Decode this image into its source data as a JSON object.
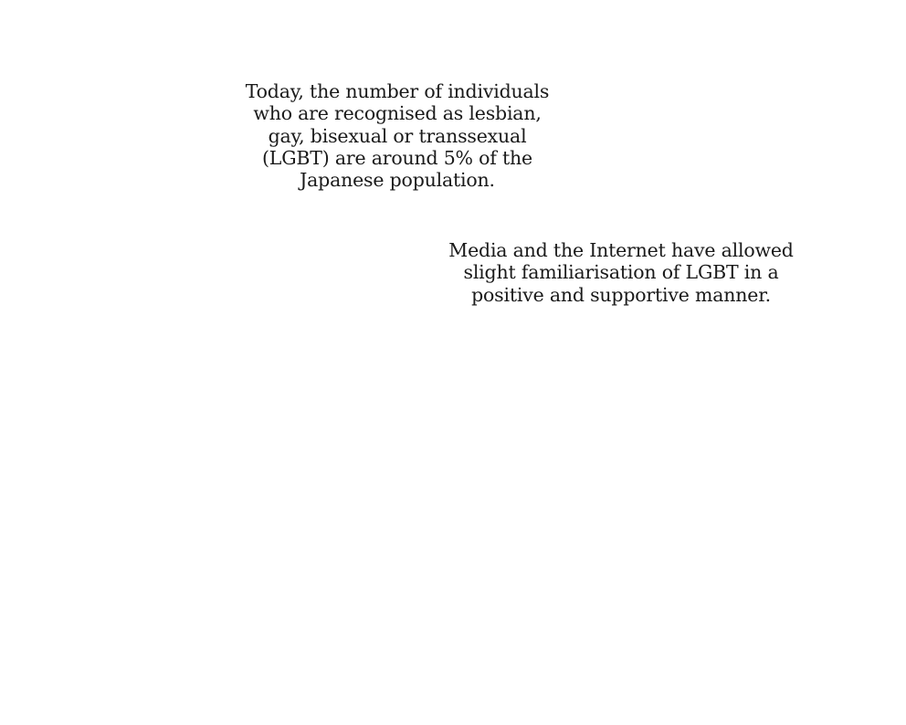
{
  "paragraphs": [
    {
      "lines": [
        "Today, the number of individuals",
        "who are recognised as lesbian,",
        "gay, bisexual or transsexual",
        "(LGBT) are around 5% of the",
        "Japanese population."
      ]
    },
    {
      "lines": [
        "Media and the Internet have allowed",
        "slight familiarisation of LGBT in a",
        "positive and supportive manner."
      ]
    }
  ]
}
